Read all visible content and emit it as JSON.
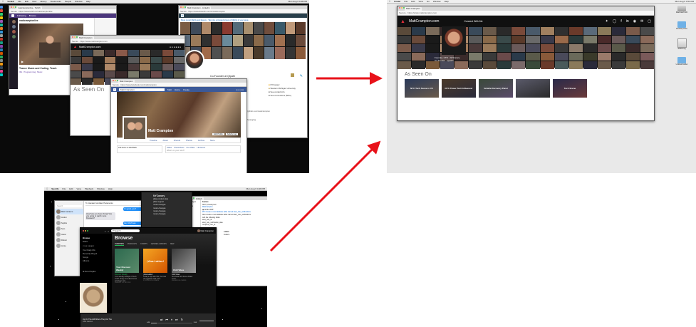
{
  "colors": {
    "arrow": "#e8121a",
    "mac_menubar": "#e8e8e8",
    "twitch_purple": "#6441a4",
    "facebook_blue": "#3b5998",
    "linkedin_blue": "#0077b5",
    "spotify_green": "#1db954",
    "site_accent": "#e0303a",
    "folder_blue": "#6fb1e6"
  },
  "screenshot_before": {
    "menubar": {
      "app": "Vivaldi",
      "items": [
        "File",
        "Edit",
        "View",
        "History",
        "Bookmarks",
        "People",
        "Window",
        "Help"
      ],
      "clock": "Mon Aug 6  4:48 PM"
    },
    "twitch_window": {
      "tab": "mattcramptonlive - Twitch",
      "url": "Secure · https://www.twitch.tv/mattcramptonlive",
      "nav": [
        "Following",
        "Browse"
      ],
      "channel": "mattcramptonlive",
      "stream_title": "Trance Music and Coding. Teach",
      "tags": [
        "IRL",
        "Programming",
        "Music"
      ]
    },
    "site_window": {
      "tab": "Matt Crampton",
      "url": "Secure · https://www.mattcrampton.com",
      "logo_text": "MattCrampton.com",
      "role_line": "Founder, CTO · NYCanary",
      "role_line2": "Co-founder · Qtpath",
      "section": "As Seen On"
    },
    "linkedin_window": {
      "tab": "Matt Crampton - Linkedin",
      "url": "Secure · https://www.linkedin.com/in/mattcrampton",
      "banner": "Meet Local CEOs and Execs · Tap into a trusted group of CEOs in your area",
      "headline": "Co-Founder at Qtpath",
      "info": [
        "NYCanary",
        "Western Michigan University",
        "See contact info",
        "See connections (500+)"
      ],
      "url_note": "https://github.com/mattcrampton",
      "messaging": "Messaging"
    },
    "facebook_window": {
      "tab": "Matt Crampton",
      "url": "Secure · https://www.facebook.com/mattcrampton",
      "search_placeholder": "Matt Crampton",
      "nav": [
        "Matt",
        "Home",
        "Create"
      ],
      "profile_name": "Matt Crampton",
      "buttons": [
        "Edit Profile",
        "Activity Log"
      ],
      "tabs": [
        "Timeline",
        "About",
        "Friends",
        "Photos",
        "Archive",
        "More"
      ],
      "left_text": "240 Items to Add Back",
      "composer": [
        "Status",
        "Photo/Video",
        "Live Video",
        "Life Event"
      ],
      "composer_prompt": "What's on your mind?"
    }
  },
  "screenshot_after": {
    "menubar": {
      "app": "Finder",
      "items": [
        "File",
        "Edit",
        "View",
        "Go",
        "Window",
        "Help"
      ],
      "clock": "Mon Aug 6  4:51 PM"
    },
    "browser": {
      "tab": "Matt Crampton",
      "url": "Secure · https://www.mattcrampton.com"
    },
    "site": {
      "logo_text": "MattCrampton.com",
      "nav_link": "Connect With Me",
      "role_line": "Founder, CTO · NYCanary",
      "role_line2": "Co-founder · Qtpath",
      "section": "As Seen On",
      "tiles": [
        {
          "title": "NYC Tech Scene in VC"
        },
        {
          "title": "NYC Power Tech Influencer"
        },
        {
          "title": "Vehicle Recovery Panel"
        },
        {
          "title": ""
        },
        {
          "title": "Tech Scene"
        }
      ]
    },
    "desktop_icons": [
      {
        "label": "Macintosh HD",
        "icon": "hard-drive-icon"
      },
      {
        "label": "Desktop Files",
        "icon": "folder-icon"
      },
      {
        "label": "SHR.dmg",
        "icon": "disk-image-icon"
      },
      {
        "label": "Untitled Folder",
        "icon": "folder-icon"
      }
    ]
  },
  "screenshot_spotify": {
    "menubar": {
      "app": "Spotify",
      "items": [
        "File",
        "Edit",
        "View",
        "Playback",
        "Window",
        "Help"
      ],
      "clock": "Mon Aug 6  4:49 PM"
    },
    "messages_window": {
      "search_placeholder": "Search",
      "contacts": [
        "Matt Carrasco",
        "Andrei",
        "Sophie",
        "Sam",
        "Jason",
        "Robert",
        "Annie"
      ],
      "header_to": "To: Hanako Gonzalez Pacamento",
      "bubbles": [
        "I'm good, you?",
        "How have you been doing? Are you going to watch more Russians?",
        "Hey! We'll see",
        "yeah I am! Should make it by 7pm"
      ]
    },
    "spotify": {
      "search_placeholder": "Search",
      "user": "Matt Crampton",
      "sidebar": [
        "Browse",
        "Radio",
        "YOUR LIBRARY",
        "Your Daily Mix",
        "Recently Played",
        "Songs",
        "Albums"
      ],
      "new_playlist": "New Playlist",
      "title": "Browse",
      "tabs": [
        "OVERVIEW",
        "PODCASTS",
        "CHARTS",
        "GENRES & MOODS",
        "NEW"
      ],
      "cards": [
        {
          "title": "Discover Weekly",
          "art_title": "Your Discover Weekly",
          "desc": "Your weekly mixtape of fresh music. Enjoy new discoveries and deep cuts.",
          "meta": "PLAYLIST · BY SPOTIFY"
        },
        {
          "title": "¡Viva Latino!",
          "art_title": "¡Viva Latino!",
          "desc": "Today's top Latin hits, the best of reggaeton and more.",
          "meta": "9,321,960 FOLLOWERS"
        },
        {
          "title": "Chill Vibes",
          "art_title": "Chill Vibes",
          "desc": "Kick back with these chilled tunes.",
          "meta": "698,408 FOLLOWERS"
        }
      ],
      "now_playing_title": "Up On The Hill Where They Do The",
      "now_playing_artist": "Jack Harlow",
      "time_elapsed": "0:25",
      "time_total": "3:14"
    },
    "github_window": {
      "tab": "GitHub",
      "sidebar_items": [
        "Messages",
        "Inbox",
        "Teams"
      ],
      "header": "Feature",
      "entries": [
        "Alert (unread) item",
        "Mattcrampton",
        "GitHub APP",
        "PR: Create a new database table named alert_rule_notifications",
        "Also create a new database table named alert_rule_notifications",
        "with the following fields:",
        "alert_rule_id",
        "alert_rule_notification_date",
        "recipient_user_id"
      ],
      "labels_title": "Labels",
      "label": "Feature"
    },
    "nyc_overlay": {
      "title": "NYCanary",
      "items": [
        "pillar-product-data",
        "pillar-support",
        "router-changes",
        "router-changes",
        "router-changes",
        "router-changes"
      ]
    }
  }
}
